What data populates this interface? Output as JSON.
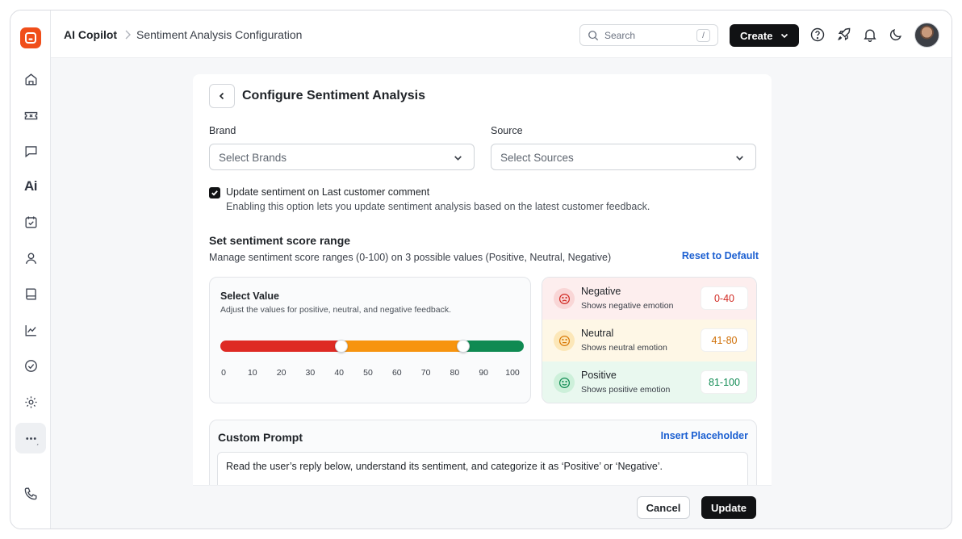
{
  "breadcrumb": {
    "app": "AI Copilot",
    "page": "Sentiment Analysis Configuration"
  },
  "search": {
    "placeholder": "Search",
    "shortcut": "/"
  },
  "header": {
    "create_label": "Create"
  },
  "sidebar": {
    "items": [
      {
        "icon": "home-icon"
      },
      {
        "icon": "ticket-icon"
      },
      {
        "icon": "chat-icon"
      },
      {
        "icon": "ai-icon",
        "label": "Ai"
      },
      {
        "icon": "calendar-check-icon"
      },
      {
        "icon": "user-icon"
      },
      {
        "icon": "book-icon"
      },
      {
        "icon": "analytics-icon"
      },
      {
        "icon": "check-circle-icon"
      },
      {
        "icon": "settings-icon"
      },
      {
        "icon": "more-icon",
        "active": true
      },
      {
        "icon": "phone-icon"
      }
    ]
  },
  "form": {
    "title": "Configure Sentiment Analysis",
    "brand": {
      "label": "Brand",
      "placeholder": "Select Brands"
    },
    "source": {
      "label": "Source",
      "placeholder": "Select Sources"
    },
    "update_on_last_comment": {
      "checked": true,
      "label": "Update sentiment on Last customer comment",
      "description": "Enabling this option lets you update sentiment analysis based on the latest customer feedback."
    },
    "score_range": {
      "title": "Set sentiment score range",
      "description": "Manage sentiment score ranges (0-100) on 3 possible values (Positive, Neutral, Negative)",
      "reset_label": "Reset to Default",
      "slider": {
        "title": "Select Value",
        "description": "Adjust the values for positive, neutral, and negative feedback.",
        "min": 0,
        "max": 100,
        "thumb_low": 40,
        "thumb_high": 80,
        "ticks": [
          "0",
          "10",
          "20",
          "30",
          "40",
          "50",
          "60",
          "70",
          "80",
          "90",
          "100"
        ],
        "colors": {
          "negative": "#de2a24",
          "neutral": "#f7940f",
          "positive": "#0f8a52"
        }
      },
      "sentiments": [
        {
          "name": "Negative",
          "description": "Shows negative emotion",
          "range": "0-40",
          "icon": "sad-face-icon"
        },
        {
          "name": "Neutral",
          "description": "Shows neutral emotion",
          "range": "41-80",
          "icon": "neutral-face-icon"
        },
        {
          "name": "Positive",
          "description": "Shows positive emotion",
          "range": "81-100",
          "icon": "happy-face-icon"
        }
      ]
    },
    "custom_prompt": {
      "title": "Custom Prompt",
      "insert_label": "Insert Placeholder",
      "value": "Read the user’s reply below, understand its sentiment, and categorize it as ‘Positive’ or ‘Negative’."
    },
    "actions": {
      "cancel_label": "Cancel",
      "update_label": "Update"
    }
  }
}
